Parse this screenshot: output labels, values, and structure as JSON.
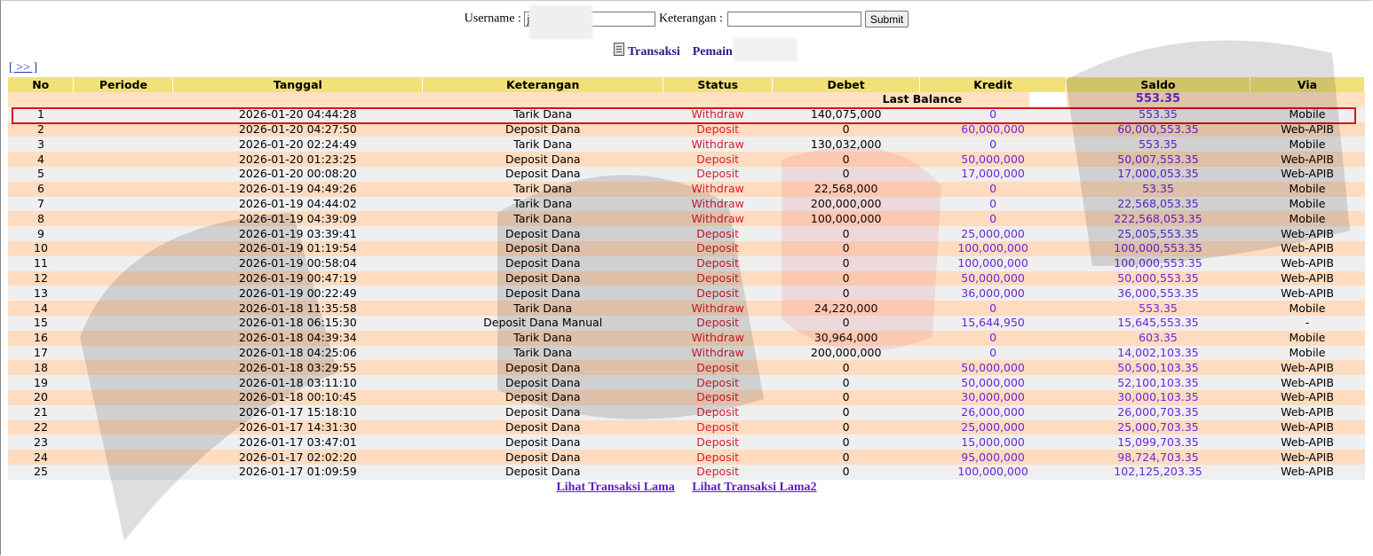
{
  "search": {
    "username_label": "Username :",
    "username_value": "j",
    "keterangan_label": "Keterangan :",
    "keterangan_value": "",
    "submit_label": "Submit"
  },
  "heading": {
    "transaksi": "Transaksi",
    "pemain": "Pemain : jhe"
  },
  "nav": {
    "next": "[ >> ]"
  },
  "table": {
    "headers": [
      "No",
      "Periode",
      "Tanggal",
      "Keterangan",
      "Status",
      "Debet",
      "Kredit",
      "Saldo",
      "Via"
    ],
    "last_balance_label": "Last Balance",
    "last_balance_value": "553.35",
    "rows": [
      {
        "no": "1",
        "periode": "",
        "tanggal": "2026-01-20 04:44:28",
        "keterangan": "Tarik Dana",
        "status": "Withdraw",
        "debet": "140,075,000",
        "kredit": "0",
        "saldo": "553.35",
        "via": "Mobile"
      },
      {
        "no": "2",
        "periode": "",
        "tanggal": "2026-01-20 04:27:50",
        "keterangan": "Deposit Dana",
        "status": "Deposit",
        "debet": "0",
        "kredit": "60,000,000",
        "saldo": "60,000,553.35",
        "via": "Web-APIB"
      },
      {
        "no": "3",
        "periode": "",
        "tanggal": "2026-01-20 02:24:49",
        "keterangan": "Tarik Dana",
        "status": "Withdraw",
        "debet": "130,032,000",
        "kredit": "0",
        "saldo": "553.35",
        "via": "Mobile"
      },
      {
        "no": "4",
        "periode": "",
        "tanggal": "2026-01-20 01:23:25",
        "keterangan": "Deposit Dana",
        "status": "Deposit",
        "debet": "0",
        "kredit": "50,000,000",
        "saldo": "50,007,553.35",
        "via": "Web-APIB"
      },
      {
        "no": "5",
        "periode": "",
        "tanggal": "2026-01-20 00:08:20",
        "keterangan": "Deposit Dana",
        "status": "Deposit",
        "debet": "0",
        "kredit": "17,000,000",
        "saldo": "17,000,053.35",
        "via": "Web-APIB"
      },
      {
        "no": "6",
        "periode": "",
        "tanggal": "2026-01-19 04:49:26",
        "keterangan": "Tarik Dana",
        "status": "Withdraw",
        "debet": "22,568,000",
        "kredit": "0",
        "saldo": "53.35",
        "via": "Mobile"
      },
      {
        "no": "7",
        "periode": "",
        "tanggal": "2026-01-19 04:44:02",
        "keterangan": "Tarik Dana",
        "status": "Withdraw",
        "debet": "200,000,000",
        "kredit": "0",
        "saldo": "22,568,053.35",
        "via": "Mobile"
      },
      {
        "no": "8",
        "periode": "",
        "tanggal": "2026-01-19 04:39:09",
        "keterangan": "Tarik Dana",
        "status": "Withdraw",
        "debet": "100,000,000",
        "kredit": "0",
        "saldo": "222,568,053.35",
        "via": "Mobile"
      },
      {
        "no": "9",
        "periode": "",
        "tanggal": "2026-01-19 03:39:41",
        "keterangan": "Deposit Dana",
        "status": "Deposit",
        "debet": "0",
        "kredit": "25,000,000",
        "saldo": "25,005,553.35",
        "via": "Web-APIB"
      },
      {
        "no": "10",
        "periode": "",
        "tanggal": "2026-01-19 01:19:54",
        "keterangan": "Deposit Dana",
        "status": "Deposit",
        "debet": "0",
        "kredit": "100,000,000",
        "saldo": "100,000,553.35",
        "via": "Web-APIB"
      },
      {
        "no": "11",
        "periode": "",
        "tanggal": "2026-01-19 00:58:04",
        "keterangan": "Deposit Dana",
        "status": "Deposit",
        "debet": "0",
        "kredit": "100,000,000",
        "saldo": "100,000,553.35",
        "via": "Web-APIB"
      },
      {
        "no": "12",
        "periode": "",
        "tanggal": "2026-01-19 00:47:19",
        "keterangan": "Deposit Dana",
        "status": "Deposit",
        "debet": "0",
        "kredit": "50,000,000",
        "saldo": "50,000,553.35",
        "via": "Web-APIB"
      },
      {
        "no": "13",
        "periode": "",
        "tanggal": "2026-01-19 00:22:49",
        "keterangan": "Deposit Dana",
        "status": "Deposit",
        "debet": "0",
        "kredit": "36,000,000",
        "saldo": "36,000,553.35",
        "via": "Web-APIB"
      },
      {
        "no": "14",
        "periode": "",
        "tanggal": "2026-01-18 11:35:58",
        "keterangan": "Tarik Dana",
        "status": "Withdraw",
        "debet": "24,220,000",
        "kredit": "0",
        "saldo": "553.35",
        "via": "Mobile"
      },
      {
        "no": "15",
        "periode": "",
        "tanggal": "2026-01-18 06:15:30",
        "keterangan": "Deposit Dana Manual",
        "status": "Deposit",
        "debet": "0",
        "kredit": "15,644,950",
        "saldo": "15,645,553.35",
        "via": "-"
      },
      {
        "no": "16",
        "periode": "",
        "tanggal": "2026-01-18 04:39:34",
        "keterangan": "Tarik Dana",
        "status": "Withdraw",
        "debet": "30,964,000",
        "kredit": "0",
        "saldo": "603.35",
        "via": "Mobile"
      },
      {
        "no": "17",
        "periode": "",
        "tanggal": "2026-01-18 04:25:06",
        "keterangan": "Tarik Dana",
        "status": "Withdraw",
        "debet": "200,000,000",
        "kredit": "0",
        "saldo": "14,002,103.35",
        "via": "Mobile"
      },
      {
        "no": "18",
        "periode": "",
        "tanggal": "2026-01-18 03:29:55",
        "keterangan": "Deposit Dana",
        "status": "Deposit",
        "debet": "0",
        "kredit": "50,000,000",
        "saldo": "50,500,103.35",
        "via": "Web-APIB"
      },
      {
        "no": "19",
        "periode": "",
        "tanggal": "2026-01-18 03:11:10",
        "keterangan": "Deposit Dana",
        "status": "Deposit",
        "debet": "0",
        "kredit": "50,000,000",
        "saldo": "52,100,103.35",
        "via": "Web-APIB"
      },
      {
        "no": "20",
        "periode": "",
        "tanggal": "2026-01-18 00:10:45",
        "keterangan": "Deposit Dana",
        "status": "Deposit",
        "debet": "0",
        "kredit": "30,000,000",
        "saldo": "30,000,103.35",
        "via": "Web-APIB"
      },
      {
        "no": "21",
        "periode": "",
        "tanggal": "2026-01-17 15:18:10",
        "keterangan": "Deposit Dana",
        "status": "Deposit",
        "debet": "0",
        "kredit": "26,000,000",
        "saldo": "26,000,703.35",
        "via": "Web-APIB"
      },
      {
        "no": "22",
        "periode": "",
        "tanggal": "2026-01-17 14:31:30",
        "keterangan": "Deposit Dana",
        "status": "Deposit",
        "debet": "0",
        "kredit": "25,000,000",
        "saldo": "25,000,703.35",
        "via": "Web-APIB"
      },
      {
        "no": "23",
        "periode": "",
        "tanggal": "2026-01-17 03:47:01",
        "keterangan": "Deposit Dana",
        "status": "Deposit",
        "debet": "0",
        "kredit": "15,000,000",
        "saldo": "15,099,703.35",
        "via": "Web-APIB"
      },
      {
        "no": "24",
        "periode": "",
        "tanggal": "2026-01-17 02:02:20",
        "keterangan": "Deposit Dana",
        "status": "Deposit",
        "debet": "0",
        "kredit": "95,000,000",
        "saldo": "98,724,703.35",
        "via": "Web-APIB"
      },
      {
        "no": "25",
        "periode": "",
        "tanggal": "2026-01-17 01:09:59",
        "keterangan": "Deposit Dana",
        "status": "Deposit",
        "debet": "0",
        "kredit": "100,000,000",
        "saldo": "102,125,203.35",
        "via": "Web-APIB"
      }
    ]
  },
  "footer": {
    "link1": "Lihat Transaksi Lama",
    "link2": "Lihat Transaksi Lama2"
  },
  "colors": {
    "header_bg": "#f0e278",
    "row_odd": "#efefef",
    "row_even": "#ffdcc0",
    "status_text": "#d6202e",
    "kredit_saldo_text": "#6a28d8",
    "highlight_border": "#d8141b"
  }
}
